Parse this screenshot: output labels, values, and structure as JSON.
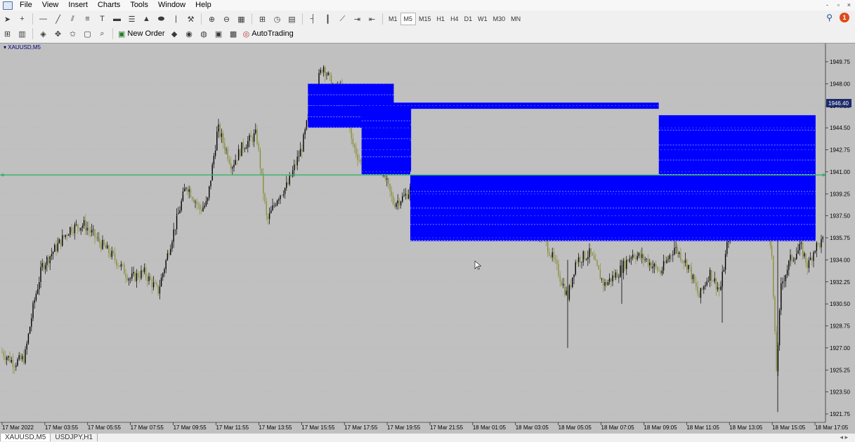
{
  "menu": [
    "File",
    "View",
    "Insert",
    "Charts",
    "Tools",
    "Window",
    "Help"
  ],
  "window_controls": [
    "-",
    "▫",
    "×"
  ],
  "timeframes": [
    "M1",
    "M5",
    "M15",
    "H1",
    "H4",
    "D1",
    "W1",
    "M30",
    "MN"
  ],
  "active_timeframe": "M5",
  "toolbar2": {
    "new_order_label": "New Order",
    "autotrading_label": "AutoTrading"
  },
  "notification_count": "1",
  "chart": {
    "title": "XAUUSD,M5",
    "current_price": "1946.40",
    "colors": {
      "background": "#c0c0c0",
      "zone": "#0000ff",
      "hline": "#3cb371",
      "candle_up": "#000000",
      "candle_down": "#8a8f3a"
    }
  },
  "chart_data": {
    "type": "candlestick",
    "symbol": "XAUUSD",
    "timeframe": "M5",
    "ylim": [
      1921.0,
      1951.0
    ],
    "y_ticks": [
      "1949.75",
      "1948.00",
      "1946.25",
      "1944.50",
      "1942.75",
      "1941.00",
      "1939.25",
      "1937.50",
      "1935.75",
      "1934.00",
      "1932.25",
      "1930.50",
      "1928.75",
      "1927.00",
      "1925.25",
      "1923.50",
      "1921.75"
    ],
    "x_ticks": [
      "17 Mar 2022",
      "17 Mar 03:55",
      "17 Mar 05:55",
      "17 Mar 07:55",
      "17 Mar 09:55",
      "17 Mar 11:55",
      "17 Mar 13:55",
      "17 Mar 15:55",
      "17 Mar 17:55",
      "17 Mar 19:55",
      "17 Mar 21:55",
      "18 Mar 01:05",
      "18 Mar 03:05",
      "18 Mar 05:05",
      "18 Mar 07:05",
      "18 Mar 09:05",
      "18 Mar 11:05",
      "18 Mar 13:05",
      "18 Mar 15:05",
      "18 Mar 17:05"
    ],
    "horizontal_line": 1940.75,
    "zones": [
      {
        "top": 1948.0,
        "bottom": 1944.5,
        "from": 0.373,
        "to": 0.477
      },
      {
        "top": 1946.5,
        "bottom": 1940.75,
        "from": 0.438,
        "to": 0.497
      },
      {
        "top": 1946.5,
        "bottom": 1946.0,
        "from": 0.497,
        "to": 0.798
      },
      {
        "top": 1946.0,
        "bottom": 1941.0,
        "from": 0.497,
        "to": 0.498
      },
      {
        "top": 1945.5,
        "bottom": 1940.75,
        "from": 0.798,
        "to": 0.988
      },
      {
        "top": 1940.75,
        "bottom": 1935.5,
        "from": 0.497,
        "to": 0.988
      }
    ]
  },
  "tabs": [
    "XAUUSD,M5",
    "USDJPY,H1"
  ]
}
